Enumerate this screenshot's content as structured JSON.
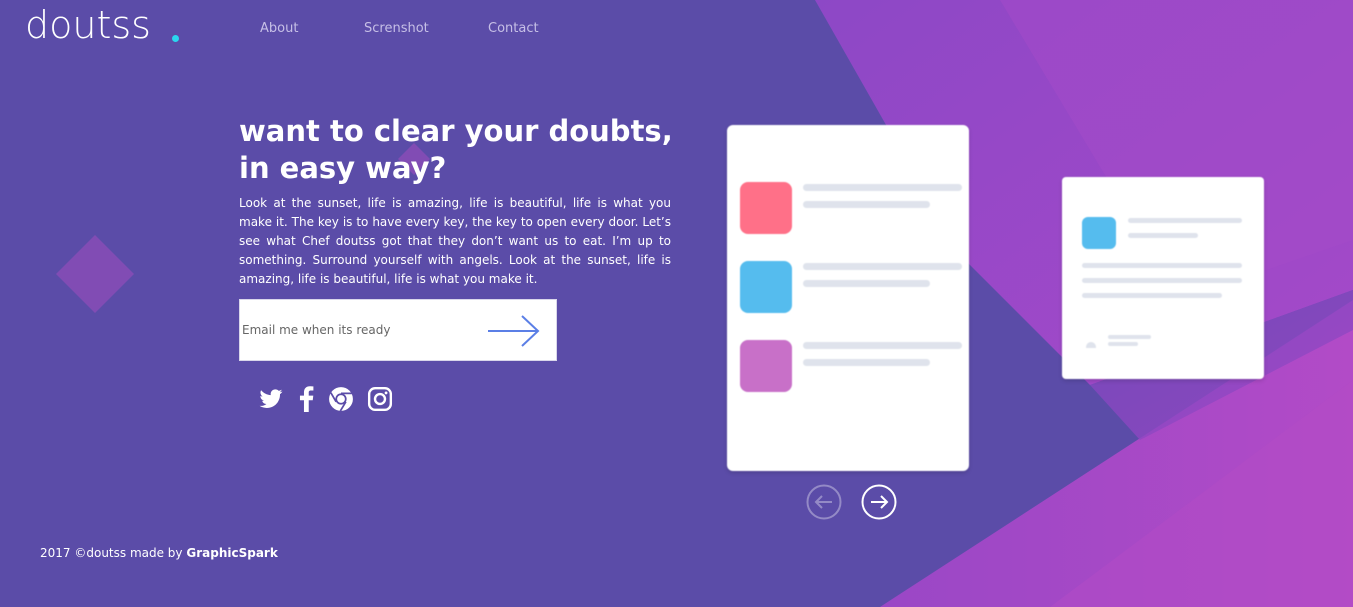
{
  "brand": {
    "logo_text": "doutss",
    "dot_color": "#2ad6ef"
  },
  "nav": {
    "items": [
      {
        "label": "About"
      },
      {
        "label": "Screnshot"
      },
      {
        "label": "Contact"
      }
    ]
  },
  "hero": {
    "headline": "want to clear your doubts, in easy way?",
    "body": "Look at the sunset, life is amazing, life is beautiful, life is what you make it. The key is to have every key, the key to open every door. Let’s see what Chef doutss got that they don’t want us to eat. I’m up to something. Surround yourself with angels. Look at the sunset, life is amazing, life is beautiful, life is what you make it."
  },
  "signup": {
    "placeholder": "Email me when its ready",
    "value": "",
    "submit_icon": "arrow-right-icon"
  },
  "social": {
    "icons": [
      "twitter-icon",
      "facebook-icon",
      "chrome-icon",
      "instagram-icon"
    ]
  },
  "preview": {
    "phone_tiles": [
      {
        "color": "#ff7088"
      },
      {
        "color": "#55bcee"
      },
      {
        "color": "#c870c8"
      }
    ],
    "tablet_tile_color": "#55bcee",
    "prev_icon": "arrow-left-circle-icon",
    "next_icon": "arrow-right-circle-icon"
  },
  "footer": {
    "text": "2017 ©doutss made by",
    "credit": "GraphicSpark"
  },
  "colors": {
    "background": "#5b4ca8",
    "accent_purple": "#a046c8",
    "skeleton_line": "#dfe3ec"
  }
}
